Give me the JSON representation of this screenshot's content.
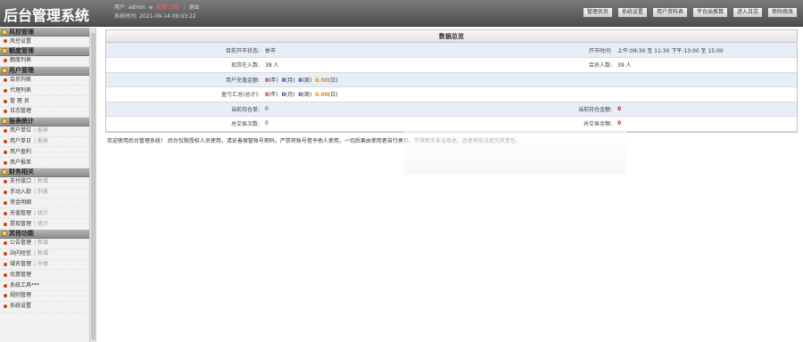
{
  "header": {
    "title": "后台管理系统",
    "user_label": "用户:",
    "user_name": "admin",
    "role": "超管(1级)",
    "logout": "退出",
    "time_label": "系统时间:",
    "time_value": "2021-09-14 09:03:22",
    "buttons": [
      "管理员页",
      "系统设置",
      "用户资料表",
      "平台出推算",
      "进入日志",
      "密码修改"
    ]
  },
  "sidebar": {
    "groups": [
      {
        "title": "风控管理",
        "items": [
          {
            "label": "风控设置",
            "sub": ""
          }
        ]
      },
      {
        "title": "额度管理",
        "items": [
          {
            "label": "额度列表",
            "sub": ""
          }
        ]
      },
      {
        "title": "用户管理",
        "items": [
          {
            "label": "会员列表",
            "sub": ""
          },
          {
            "label": "代理列表",
            "sub": ""
          },
          {
            "label": "管 理 员",
            "sub": ""
          },
          {
            "label": "日志管理",
            "sub": ""
          }
        ]
      },
      {
        "title": "报表统计",
        "items": [
          {
            "label": "用户单位",
            "sub": "| 报表"
          },
          {
            "label": "用户单日",
            "sub": "| 报表"
          },
          {
            "label": "用户盈利",
            "sub": ""
          },
          {
            "label": "用户报单",
            "sub": ""
          }
        ]
      },
      {
        "title": "财务相关",
        "items": [
          {
            "label": "支付接口",
            "sub": "| 新增"
          },
          {
            "label": "手动入款",
            "sub": "| 列表"
          },
          {
            "label": "资金明细",
            "sub": ""
          },
          {
            "label": "充值管理",
            "sub": "| 统计"
          },
          {
            "label": "提现管理",
            "sub": "| 统计"
          }
        ]
      },
      {
        "title": "其他功能",
        "items": [
          {
            "label": "公告管理",
            "sub": "| 新增"
          },
          {
            "label": "站内短信",
            "sub": "| 新增"
          },
          {
            "label": "域名管理",
            "sub": "| 分类"
          },
          {
            "label": "优惠管理",
            "sub": ""
          },
          {
            "label": "系统工具***",
            "sub": ""
          },
          {
            "label": "规则管理",
            "sub": ""
          },
          {
            "label": "系统设置",
            "sub": ""
          }
        ]
      }
    ]
  },
  "overview": {
    "title": "数据总览",
    "rows": [
      {
        "l1": "目前开市状态:",
        "v1": "休市",
        "l2": "开市时间:",
        "v2": "上午:09:30 至 11:30  下午:13:00 至 15:00"
      },
      {
        "l1": "现货在入数:",
        "v1": "38 人",
        "l2": "会员人数:",
        "v2": "39 人"
      },
      {
        "l1": "用户充值金额:",
        "v1_parts": [
          "0",
          "(年)",
          "0",
          "(月)",
          "0",
          "(周)",
          "0.00",
          "(日)"
        ],
        "l2": "",
        "v2": ""
      },
      {
        "l1": "盈亏汇总(总计):",
        "v1_parts": [
          "0",
          "(年)",
          "0",
          "(月)",
          "0",
          "(周)",
          "0.00",
          "(日)"
        ],
        "l2": "",
        "v2": ""
      },
      {
        "l1": "当前持仓单:",
        "v1": "0",
        "l2": "当前持仓金额:",
        "v2": "0"
      },
      {
        "l1": "总交易次数:",
        "v1": "0",
        "l2": "总交易金额:",
        "v2": "0"
      }
    ],
    "notice": "欢迎使用后台管理系统！ 后台仅限授权人员使用，请妥善保管账号密码，严禁将账号借予他人使用，一切后果由使用者自行承担。不得用于非法用途，违者将依法追究其责任。"
  },
  "colors": {
    "accent_red": "#d21010",
    "accent_blue": "#1a2b9a",
    "accent_orange": "#e08a00",
    "row_alt": "#e7eef7"
  }
}
